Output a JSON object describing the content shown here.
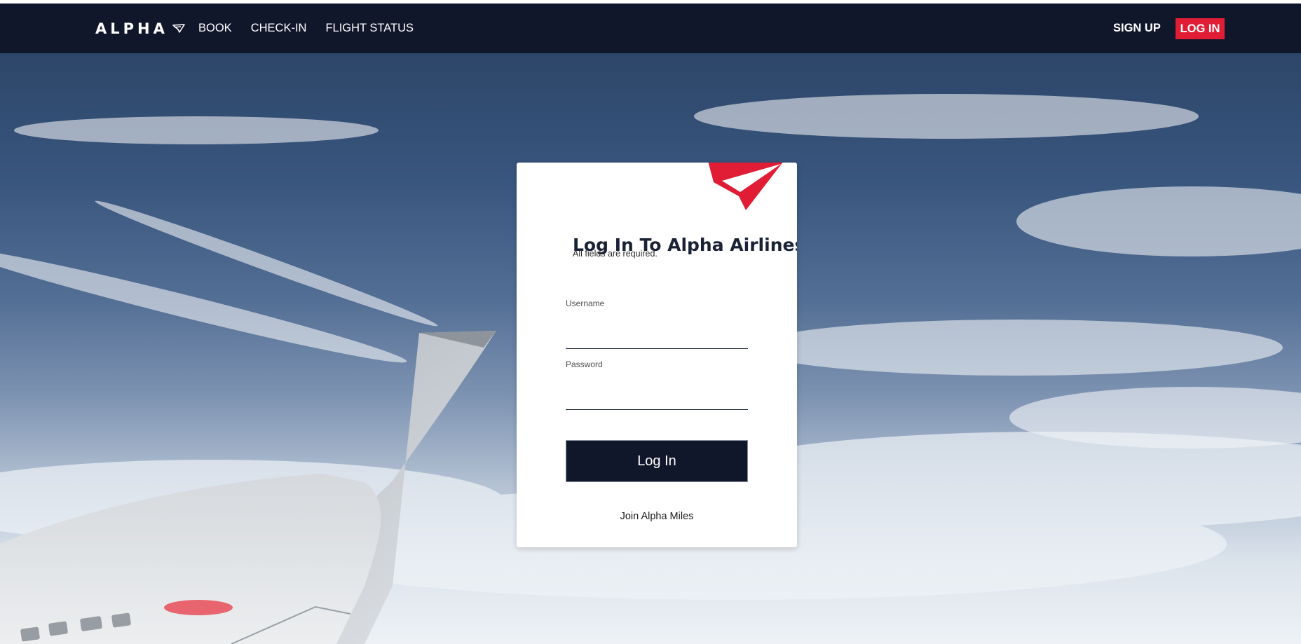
{
  "brand": {
    "name": "ALPHA",
    "accent": "#e11d35",
    "navy": "#11172b"
  },
  "nav": {
    "links": [
      "BOOK",
      "CHECK-IN",
      "FLIGHT STATUS"
    ],
    "signup_label": "SIGN UP",
    "login_label": "LOG IN"
  },
  "login": {
    "title": "Log In To Alpha Airlines",
    "subtitle": "All fields are required.",
    "username_label": "Username",
    "username_value": "",
    "password_label": "Password",
    "password_value": "",
    "submit_label": "Log In",
    "join_label": "Join Alpha Miles"
  },
  "icons": {
    "logo": "paper-plane-icon",
    "card_mark": "paper-plane-icon"
  },
  "hero": {
    "description_icon": "airplane-wing-over-clouds"
  }
}
